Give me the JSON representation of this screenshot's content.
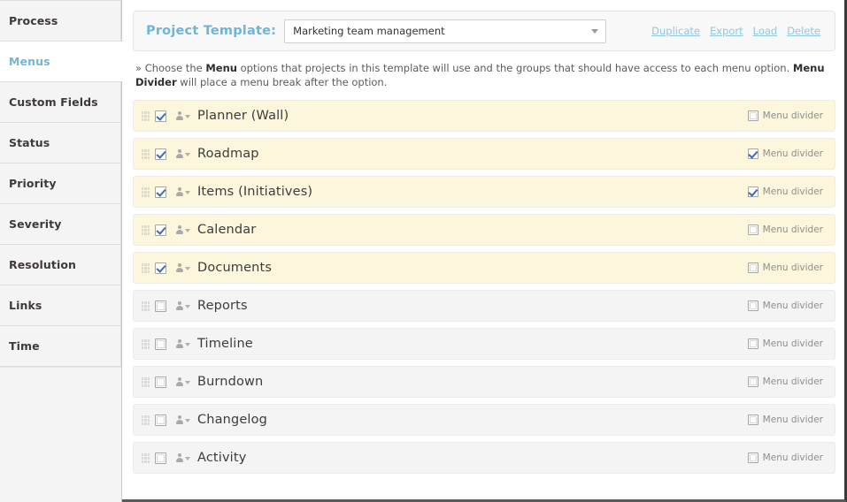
{
  "sidebar": {
    "items": [
      {
        "label": "Process",
        "active": false
      },
      {
        "label": "Menus",
        "active": true
      },
      {
        "label": "Custom Fields",
        "active": false
      },
      {
        "label": "Status",
        "active": false
      },
      {
        "label": "Priority",
        "active": false
      },
      {
        "label": "Severity",
        "active": false
      },
      {
        "label": "Resolution",
        "active": false
      },
      {
        "label": "Links",
        "active": false
      },
      {
        "label": "Time",
        "active": false
      }
    ]
  },
  "template_bar": {
    "label": "Project Template:",
    "select_value": "Marketing team management",
    "select_placeholder": "Marketing team management",
    "caret_icon": "chevron-down-icon",
    "actions": [
      {
        "label": "Duplicate"
      },
      {
        "label": "Export"
      },
      {
        "label": "Load"
      },
      {
        "label": "Delete"
      }
    ]
  },
  "helper": {
    "prefix": "» Choose the ",
    "bold1": "Menu",
    "mid": " options that projects in this template will use and the groups that should have access to each menu option. ",
    "bold2": "Menu Divider",
    "suffix": " will place a menu break after the option."
  },
  "divider_label": "Menu divider",
  "menu_rows": [
    {
      "label": "Planner (Wall)",
      "enabled": true,
      "divider": false
    },
    {
      "label": "Roadmap",
      "enabled": true,
      "divider": true
    },
    {
      "label": "Items (Initiatives)",
      "enabled": true,
      "divider": true
    },
    {
      "label": "Calendar",
      "enabled": true,
      "divider": false
    },
    {
      "label": "Documents",
      "enabled": true,
      "divider": false
    },
    {
      "label": "Reports",
      "enabled": false,
      "divider": false
    },
    {
      "label": "Timeline",
      "enabled": false,
      "divider": false
    },
    {
      "label": "Burndown",
      "enabled": false,
      "divider": false
    },
    {
      "label": "Changelog",
      "enabled": false,
      "divider": false
    },
    {
      "label": "Activity",
      "enabled": false,
      "divider": false
    }
  ],
  "colors": {
    "accent": "#71b4d9",
    "row_enabled_bg": "#fcf6dd",
    "row_disabled_bg": "#f4f4f4",
    "link": "#8ec6e4",
    "checkbox_check": "#3e6bb0"
  }
}
